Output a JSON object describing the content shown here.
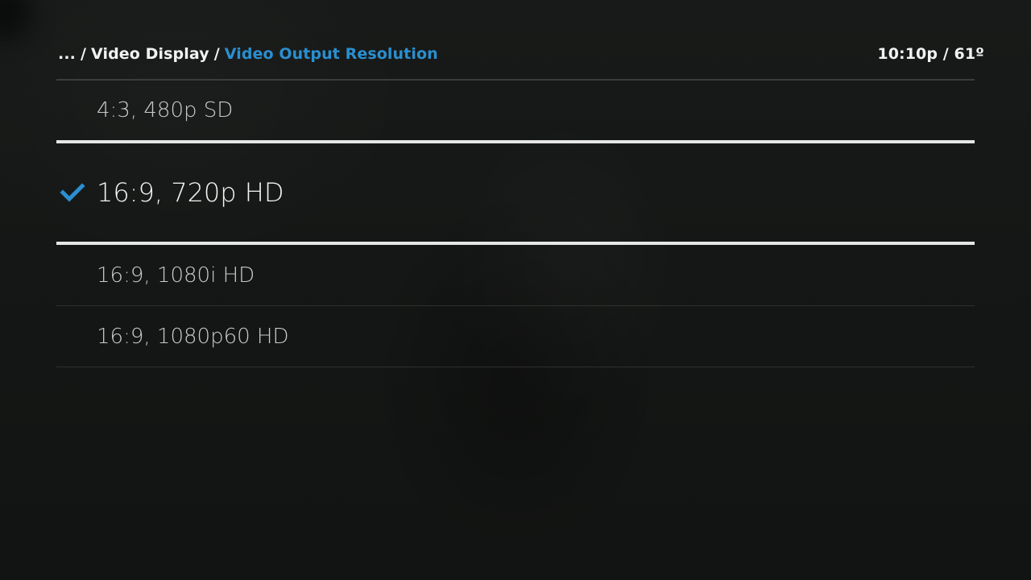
{
  "header": {
    "breadcrumb": {
      "ellipsis": "...",
      "separator": "/",
      "parent": "Video Display",
      "current": "Video Output Resolution"
    },
    "status": "10:10p / 61º"
  },
  "options": [
    {
      "label": "4:3, 480p SD",
      "selected": false,
      "focused": false
    },
    {
      "label": "16:9, 720p HD",
      "selected": true,
      "focused": true,
      "icon": "checkmark-icon"
    },
    {
      "label": "16:9, 1080i HD",
      "selected": false,
      "focused": false
    },
    {
      "label": "16:9, 1080p60 HD",
      "selected": false,
      "focused": false
    }
  ],
  "colors": {
    "accent": "#2a8fd0",
    "background": "#161817",
    "focus_border": "#e6e6e6"
  }
}
